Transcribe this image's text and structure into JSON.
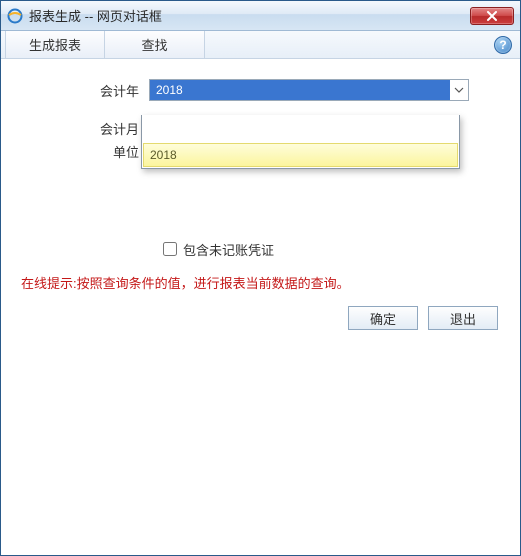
{
  "titlebar": {
    "title": "报表生成 -- 网页对话框"
  },
  "toolbar": {
    "generate_label": "生成报表",
    "search_label": "查找",
    "help_symbol": "?"
  },
  "form": {
    "year_label": "会计年",
    "year_value": "2018",
    "month_label": "会计月",
    "unit_label": "单位",
    "dropdown_option": "2018",
    "checkbox_label": "包含未记账凭证",
    "checkbox_checked": false
  },
  "tip": "在线提示:按照查询条件的值，进行报表当前数据的查询。",
  "buttons": {
    "ok": "确定",
    "exit": "退出"
  },
  "colors": {
    "tip": "#c41717",
    "highlight_bg": "#3a76d0",
    "option_bg": "#fbf59e"
  }
}
